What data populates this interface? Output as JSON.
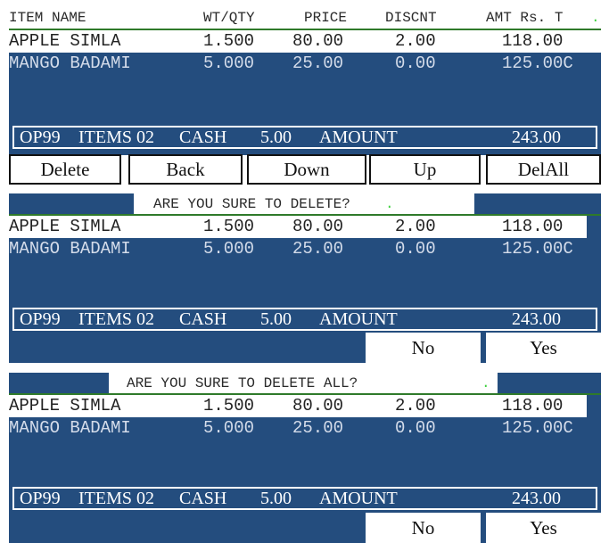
{
  "header": {
    "item_name": "ITEM NAME",
    "wt_qty": "WT/QTY",
    "price": "PRICE",
    "discount": "DISCNT",
    "amount": "AMT Rs. T",
    "dot": "."
  },
  "items": [
    {
      "name": "APPLE SIMLA",
      "qty": "1.500",
      "price": "80.00",
      "discount": "2.00",
      "amount": "118.00"
    },
    {
      "name": "MANGO BADAMI",
      "qty": "5.000",
      "price": "25.00",
      "discount": "0.00",
      "amount": "125.00C"
    }
  ],
  "summary": {
    "operator": "OP99",
    "items_label": "ITEMS 02",
    "payment": "CASH",
    "payment_value": "5.00",
    "amount_label": "AMOUNT",
    "amount_value": "243.00"
  },
  "buttons": {
    "delete": "Delete",
    "back": "Back",
    "down": "Down",
    "up": "Up",
    "delall": "DelAll"
  },
  "confirm_delete": {
    "message": "ARE YOU SURE TO DELETE?",
    "dot": ".",
    "no": "No",
    "yes": "Yes"
  },
  "confirm_delete_all": {
    "message": "ARE YOU SURE TO DELETE ALL?",
    "dot": ".",
    "no": "No",
    "yes": "Yes"
  },
  "colors": {
    "panel_blue": "#244d7e",
    "header_line_green": "#2f7a2a",
    "dot_green": "#3fd13f"
  }
}
